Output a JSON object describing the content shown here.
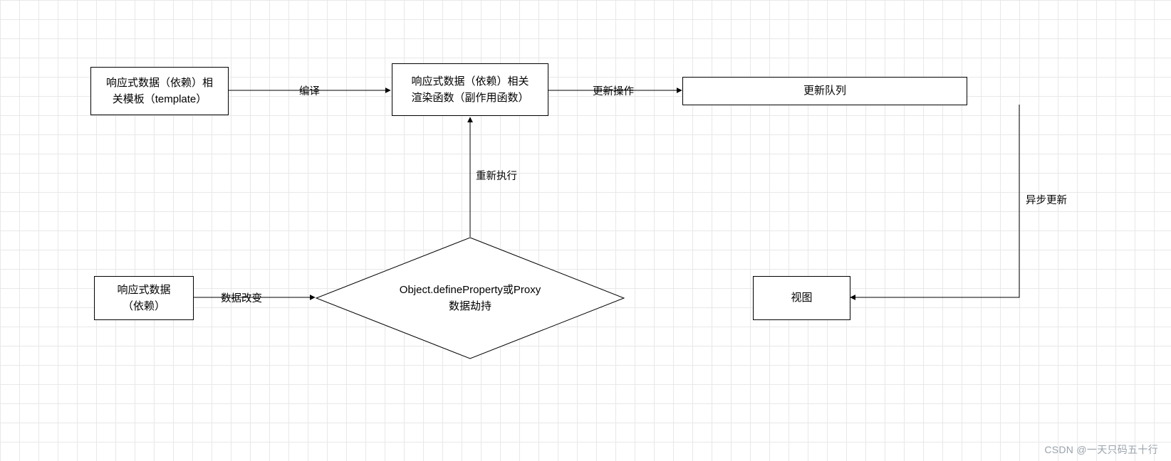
{
  "nodes": {
    "template": {
      "line1": "响应式数据（依赖）相",
      "line2": "关模板（template）"
    },
    "render": {
      "line1": "响应式数据（依赖）相关",
      "line2": "渲染函数（副作用函数）"
    },
    "queue": {
      "label": "更新队列"
    },
    "data": {
      "line1": "响应式数据",
      "line2": "（依赖）"
    },
    "decision": {
      "line1": "Object.defineProperty或Proxy",
      "line2": "数据劫持"
    },
    "view": {
      "label": "视图"
    }
  },
  "edges": {
    "compile": {
      "label": "编译"
    },
    "updateOp": {
      "label": "更新操作"
    },
    "reexec": {
      "label": "重新执行"
    },
    "dataChange": {
      "label": "数据改变"
    },
    "asyncUpd": {
      "label": "异步更新"
    }
  },
  "watermark": "CSDN @一天只码五十行"
}
